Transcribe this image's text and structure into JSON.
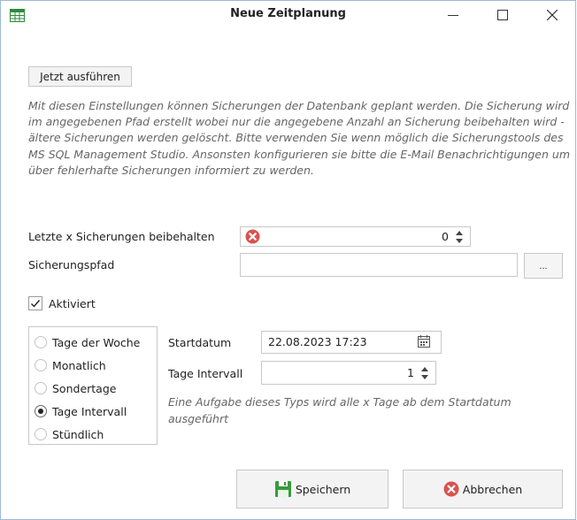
{
  "window": {
    "title": "Neue Zeitplanung",
    "icon": "table-grid-icon",
    "controls": {
      "minimize": "—",
      "maximize": "☐",
      "close": "✕"
    }
  },
  "toolbar": {
    "run_now_label": "Jetzt ausführen"
  },
  "description": "Mit diesen Einstellungen können Sicherungen der Datenbank geplant werden. Die Sicherung wird im angegebenen Pfad erstellt wobei nur die angegebene Anzahl an Sicherung beibehalten wird - ältere Sicherungen werden gelöscht. Bitte verwenden Sie wenn möglich die Sicherungstools des MS SQL Management Studio. Ansonsten konfigurieren sie bitte die E-Mail Benachrichtigungen um über fehlerhafte Sicherungen informiert zu werden.",
  "form": {
    "keep_backups": {
      "label": "Letzte x Sicherungen beibehalten",
      "value": "0",
      "error": true
    },
    "backup_path": {
      "label": "Sicherungspfad",
      "value": "",
      "browse_label": "..."
    },
    "enabled": {
      "label": "Aktiviert",
      "checked": true
    }
  },
  "schedule": {
    "options": [
      {
        "label": "Tage der Woche",
        "selected": false
      },
      {
        "label": "Monatlich",
        "selected": false
      },
      {
        "label": "Sondertage",
        "selected": false
      },
      {
        "label": "Tage Intervall",
        "selected": true
      },
      {
        "label": "Stündlich",
        "selected": false
      }
    ],
    "start_date": {
      "label": "Startdatum",
      "value": "22.08.2023 17:23"
    },
    "interval": {
      "label": "Tage Intervall",
      "value": "1"
    },
    "note": "Eine Aufgabe dieses Typs wird alle x Tage ab dem Startdatum ausgeführt"
  },
  "actions": {
    "save_label": "Speichern",
    "cancel_label": "Abbrechen"
  },
  "colors": {
    "error_red": "#d9534f",
    "save_green": "#3a9a3a",
    "window_border": "#9cb8d8"
  }
}
